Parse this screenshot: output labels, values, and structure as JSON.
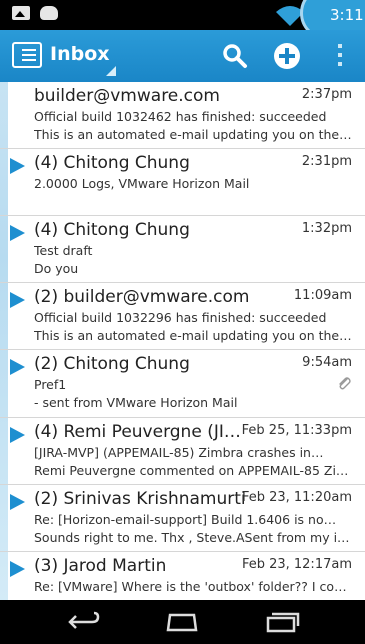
{
  "status_bar": {
    "time": "3:11",
    "icons": [
      "gallery-notification-icon",
      "cat-notification-icon",
      "wifi-icon"
    ]
  },
  "action_bar": {
    "title": "Inbox",
    "icons": [
      "menu-icon",
      "search-icon",
      "compose-icon",
      "overflow-menu-icon"
    ]
  },
  "emails": [
    {
      "sender": "builder@vmware.com",
      "time": "2:37pm",
      "line1": "Official build 1032462 has finished: succeeded",
      "line2": "This is an automated e-mail updating you on the…",
      "unread": false,
      "attachment": false
    },
    {
      "sender": "(4) Chitong Chung",
      "time": "2:31pm",
      "line1": "2.0000 Logs, VMware Horizon Mail",
      "line2": "",
      "unread": true,
      "attachment": false
    },
    {
      "sender": "(4) Chitong Chung",
      "time": "1:32pm",
      "line1": "Test draft",
      "line2": "Do you",
      "unread": true,
      "attachment": false
    },
    {
      "sender": "(2) builder@vmware.com",
      "time": "11:09am",
      "line1": "Official build 1032296 has finished: succeeded",
      "line2": "This is an automated e-mail updating you on the…",
      "unread": true,
      "attachment": false
    },
    {
      "sender": "(2) Chitong Chung",
      "time": "9:54am",
      "line1": "Pref1",
      "line2": "- sent from VMware Horizon Mail",
      "unread": true,
      "attachment": true
    },
    {
      "sender": "(4) Remi Peuvergne (JI…",
      "time": "Feb 25, 11:33pm",
      "line1": "[JIRA-MVP] (APPEMAIL-85) Zimbra crashes in…",
      "line2": "Remi Peuvergne commented on APPEMAIL-85 Zi…",
      "unread": true,
      "attachment": false
    },
    {
      "sender": "(2) Srinivas Krishnamurti",
      "time": "Feb 23, 11:20am",
      "line1": "Re: [Horizon-email-support] Build 1.6406 is no…",
      "line2": "Sounds right to me. Thx , Steve.ASent from my iP…",
      "unread": true,
      "attachment": false
    },
    {
      "sender": "(3) Jarod Martin",
      "time": "Feb 23, 12:17am",
      "line1": "Re: [VMware] Where is the 'outbox' folder?? I co…",
      "line2": "",
      "unread": true,
      "attachment": false
    }
  ],
  "nav_bar": {
    "icons": [
      "back-icon",
      "home-icon",
      "recent-apps-icon"
    ]
  },
  "colors": {
    "accent": "#1e8fd0",
    "action_bar": "#1a86c7"
  }
}
